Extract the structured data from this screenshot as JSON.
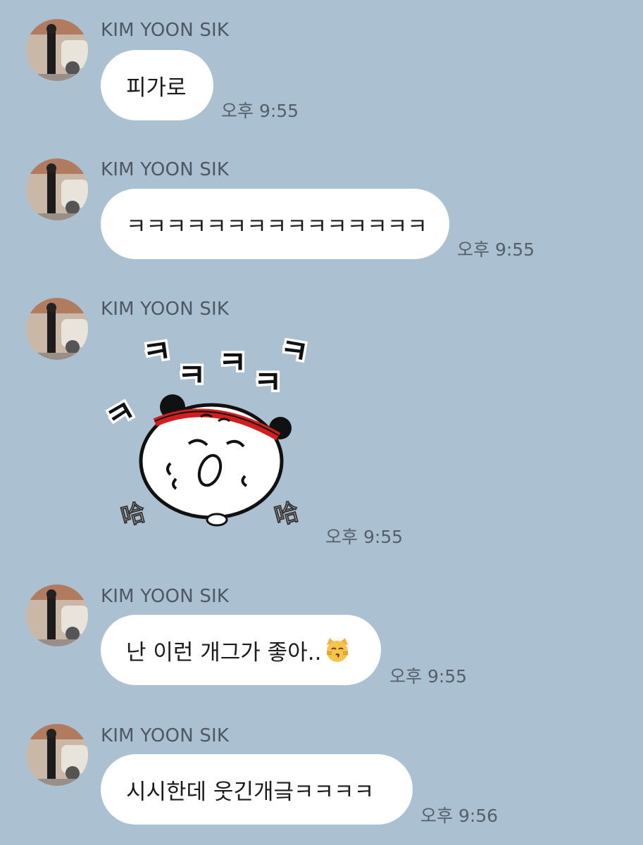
{
  "chat": {
    "messages": [
      {
        "sender": "KIM YOON SIK",
        "text": "피가로",
        "time": "오후 9:55"
      },
      {
        "sender": "KIM YOON SIK",
        "text": "ㅋㅋㅋㅋㅋㅋㅋㅋㅋㅋㅋㅋㅋㅋㅋ",
        "time": "오후 9:55"
      },
      {
        "sender": "KIM YOON SIK",
        "sticker": "laughing-dumpling-sticker",
        "sticker_text": [
          "ㅋ",
          "ㅋ",
          "ㅋ",
          "ㅋ",
          "ㅋ",
          "ㅋ",
          "哈",
          "哈"
        ],
        "time": "오후 9:55"
      },
      {
        "sender": "KIM YOON SIK",
        "text": "난 이런 개그가 좋아..",
        "emoji": "kissing-cat-emoji",
        "time": "오후 9:55"
      },
      {
        "sender": "KIM YOON SIK",
        "text": "시시한데 웃긴개긐ㅋㅋㅋㅋ",
        "time": "오후 9:56"
      }
    ]
  },
  "colors": {
    "background": "#abc0d1",
    "bubble": "#ffffff",
    "sender_text": "#4e5864",
    "time_text": "#55606b"
  }
}
